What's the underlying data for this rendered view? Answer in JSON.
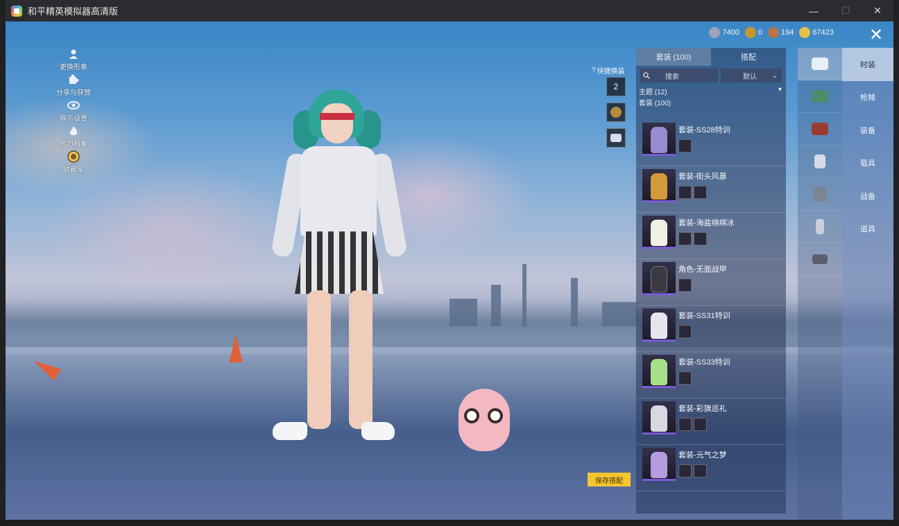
{
  "window": {
    "title": "和平精英模拟器高清版",
    "controls": {
      "minimize": "—",
      "maximize": "☐",
      "close": "✕"
    }
  },
  "left_menu": [
    {
      "label": "更换形象",
      "icon": "person-icon"
    },
    {
      "label": "分享与获赞",
      "icon": "puzzle-icon"
    },
    {
      "label": "展示设置",
      "icon": "eye-icon"
    },
    {
      "label": "热力档案",
      "icon": "flame-icon"
    },
    {
      "label": "收藏家",
      "icon": "medal-icon"
    }
  ],
  "currency": [
    {
      "value": "7400",
      "icon": "silver-coin-icon",
      "color": "#9aa3b8"
    },
    {
      "value": "0",
      "icon": "gold-token-icon",
      "color": "#c8962f"
    },
    {
      "value": "194",
      "icon": "bronze-token-icon",
      "color": "#b9744a"
    },
    {
      "value": "67423",
      "icon": "gold-coin-icon",
      "color": "#e7c04a"
    }
  ],
  "quick_swap": {
    "label": "快捷换装",
    "slot_number": "2"
  },
  "panel": {
    "tabs": [
      {
        "label": "套装 (100)",
        "active": true
      },
      {
        "label": "搭配",
        "active": false
      }
    ],
    "search_placeholder": "搜索",
    "sort_label": "默认",
    "theme_label": "主题 (12)",
    "group_label": "套装 (100)",
    "items": [
      {
        "name": "套装-SS28特训",
        "color": "#9a8ad0",
        "subs": 1
      },
      {
        "name": "套装-街头风暴",
        "color": "#d49a3a",
        "subs": 2
      },
      {
        "name": "套装-海盐绵绵冰",
        "color": "#f2efe4",
        "subs": 2
      },
      {
        "name": "角色-无面战甲",
        "color": "#3a3a44",
        "subs": 1
      },
      {
        "name": "套装-SS31特训",
        "color": "#e5e5ee",
        "subs": 1
      },
      {
        "name": "套装-SS33特训",
        "color": "#a8e08a",
        "subs": 1
      },
      {
        "name": "套装-彩旗巡礼",
        "color": "#d8d8e2",
        "subs": 2
      },
      {
        "name": "套装-元气之梦",
        "color": "#b79ae0",
        "subs": 2
      }
    ]
  },
  "save_button": "保存搭配",
  "categories": [
    {
      "label": "时装",
      "active": true,
      "icon": "outfit-icon",
      "color": "#e9edf5"
    },
    {
      "label": "枪械",
      "active": false,
      "icon": "gun-icon",
      "color": "#4f8a6c"
    },
    {
      "label": "装备",
      "active": false,
      "icon": "helmet-icon",
      "color": "#9a3c34"
    },
    {
      "label": "载具",
      "active": false,
      "icon": "mask-icon",
      "color": "#d7dbe4"
    },
    {
      "label": "战备",
      "active": false,
      "icon": "armor-icon",
      "color": "#7c8594"
    },
    {
      "label": "道具",
      "active": false,
      "icon": "figure-icon",
      "color": "#c9cfdc"
    },
    {
      "label": "",
      "active": false,
      "icon": "parachute-icon",
      "color": "#5a5f6c"
    }
  ]
}
